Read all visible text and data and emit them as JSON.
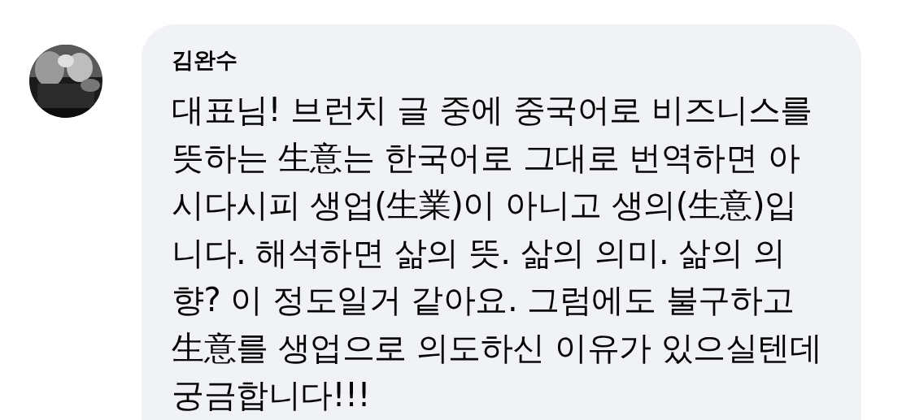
{
  "comment": {
    "author": "김완수",
    "lines": [
      "대표님! 브런치 글 중에 중국어로 비즈니스를",
      "뜻하는 生意는 한국어로 그대로 번역하면 아",
      "시다시피 생업(生業)이 아니고 생의(生意)입",
      "니다. 해석하면 삶의 뜻. 삶의 의미. 삶의 의",
      "향? 이 정도일거 같아요. 그럼에도 불구하고",
      "生意를 생업으로 의도하신 이유가 있으실텐데",
      "궁금합니다!!!"
    ]
  }
}
